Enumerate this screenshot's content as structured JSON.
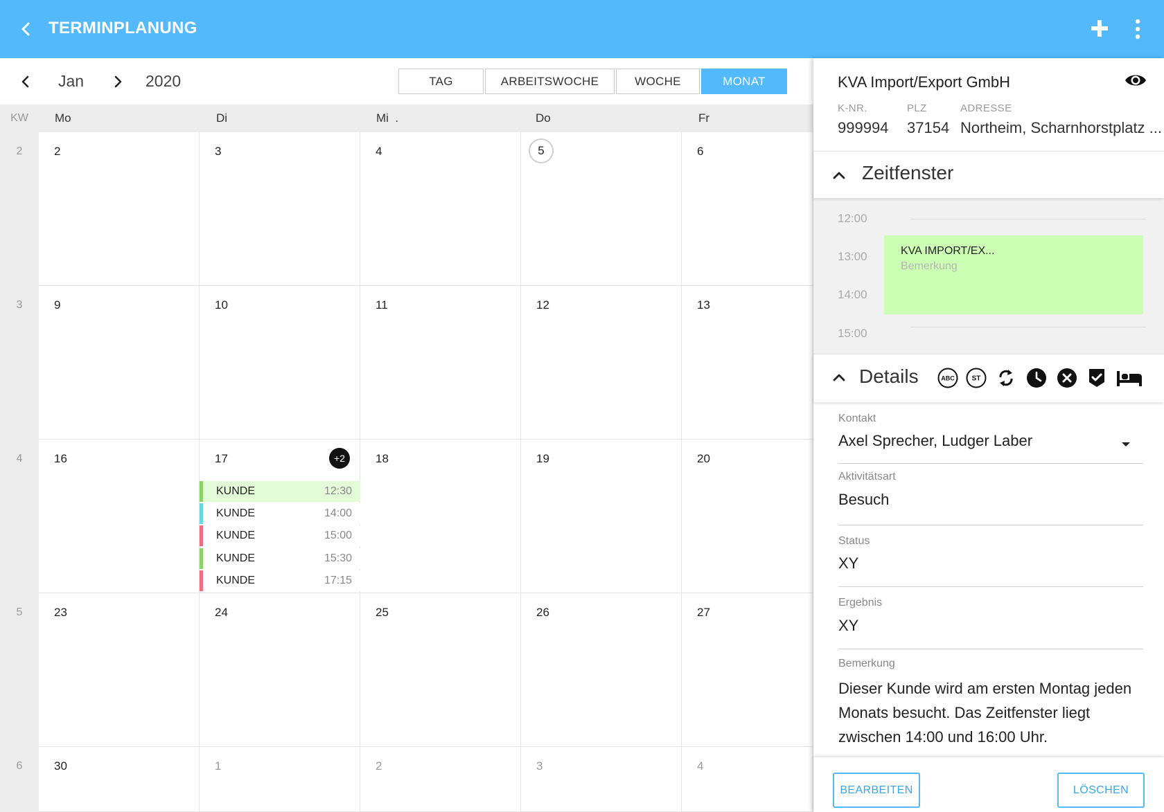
{
  "app": {
    "title": "TERMINPLANUNG"
  },
  "calendar": {
    "month": "Jan",
    "year": "2020",
    "views": [
      {
        "label": "TAG",
        "active": false
      },
      {
        "label": "ARBEITSWOCHE",
        "active": false
      },
      {
        "label": "WOCHE",
        "active": false
      },
      {
        "label": "MONAT",
        "active": true
      }
    ],
    "kw_header": "KW",
    "weekday_headers": [
      "Mo",
      "Di",
      "Mi  .",
      "Do",
      "Fr"
    ],
    "weeks": [
      {
        "kw": "2",
        "days": [
          "2",
          "3",
          "4",
          "5",
          "6"
        ]
      },
      {
        "kw": "3",
        "days": [
          "9",
          "10",
          "11",
          "12",
          "13"
        ]
      },
      {
        "kw": "4",
        "days": [
          "16",
          "17",
          "18",
          "19",
          "20"
        ]
      },
      {
        "kw": "5",
        "days": [
          "23",
          "24",
          "25",
          "26",
          "27"
        ]
      },
      {
        "kw": "6",
        "days": [
          "30",
          "1",
          "2",
          "3",
          "4"
        ]
      }
    ],
    "today_label": "5",
    "more_badge": "+2",
    "events_day17": [
      {
        "label": "KUNDE",
        "time": "12:30",
        "color": "#8cd36a",
        "bg": "#e4fbd8"
      },
      {
        "label": "KUNDE",
        "time": "14:00",
        "color": "#6ad5e3",
        "bg": "#ffffff"
      },
      {
        "label": "KUNDE",
        "time": "15:00",
        "color": "#f26c84",
        "bg": "#ffffff"
      },
      {
        "label": "KUNDE",
        "time": "15:30",
        "color": "#8cd36a",
        "bg": "#ffffff"
      },
      {
        "label": "KUNDE",
        "time": "17:15",
        "color": "#f26c84",
        "bg": "#ffffff"
      }
    ]
  },
  "panel": {
    "company": "KVA Import/Export GmbH",
    "labels": {
      "knr": "K-NR.",
      "plz": "PLZ",
      "adresse": "ADRESSE"
    },
    "values": {
      "knr": "999994",
      "plz": "37154",
      "adresse": "Northeim, Scharnhorstplatz ..."
    },
    "zeitfenster": {
      "title": "Zeitfenster",
      "times": [
        "12:00",
        "13:00",
        "14:00",
        "15:00"
      ],
      "event_title": "KVA IMPORT/EX...",
      "event_note": "Bemerkung",
      "event_color": "#ccffb3"
    },
    "details": {
      "title": "Details",
      "icons": [
        "abc-icon",
        "st-icon",
        "sync-icon",
        "clock-icon",
        "cancel-icon",
        "verified-icon",
        "bed-icon"
      ],
      "abc_text": "ABC",
      "st_text": "ST",
      "fields": {
        "kontakt_label": "Kontakt",
        "kontakt_value": "Axel Sprecher, Ludger Laber",
        "aktivitaet_label": "Aktivitätsart",
        "aktivitaet_value": "Besuch",
        "status_label": "Status",
        "status_value": "XY",
        "ergebnis_label": "Ergebnis",
        "ergebnis_value": "XY",
        "bemerkung_label": "Bemerkung",
        "bemerkung_value": "Dieser Kunde wird am ersten Montag jeden Monats besucht. Das Zeitfenster liegt zwischen 14:00 und 16:00 Uhr."
      }
    },
    "buttons": {
      "edit": "BEARBEITEN",
      "delete": "LÖSCHEN"
    }
  },
  "colors": {
    "primary": "#53b9fb",
    "accent_button": "#3aa6e8",
    "grid_header": "#ececec"
  }
}
